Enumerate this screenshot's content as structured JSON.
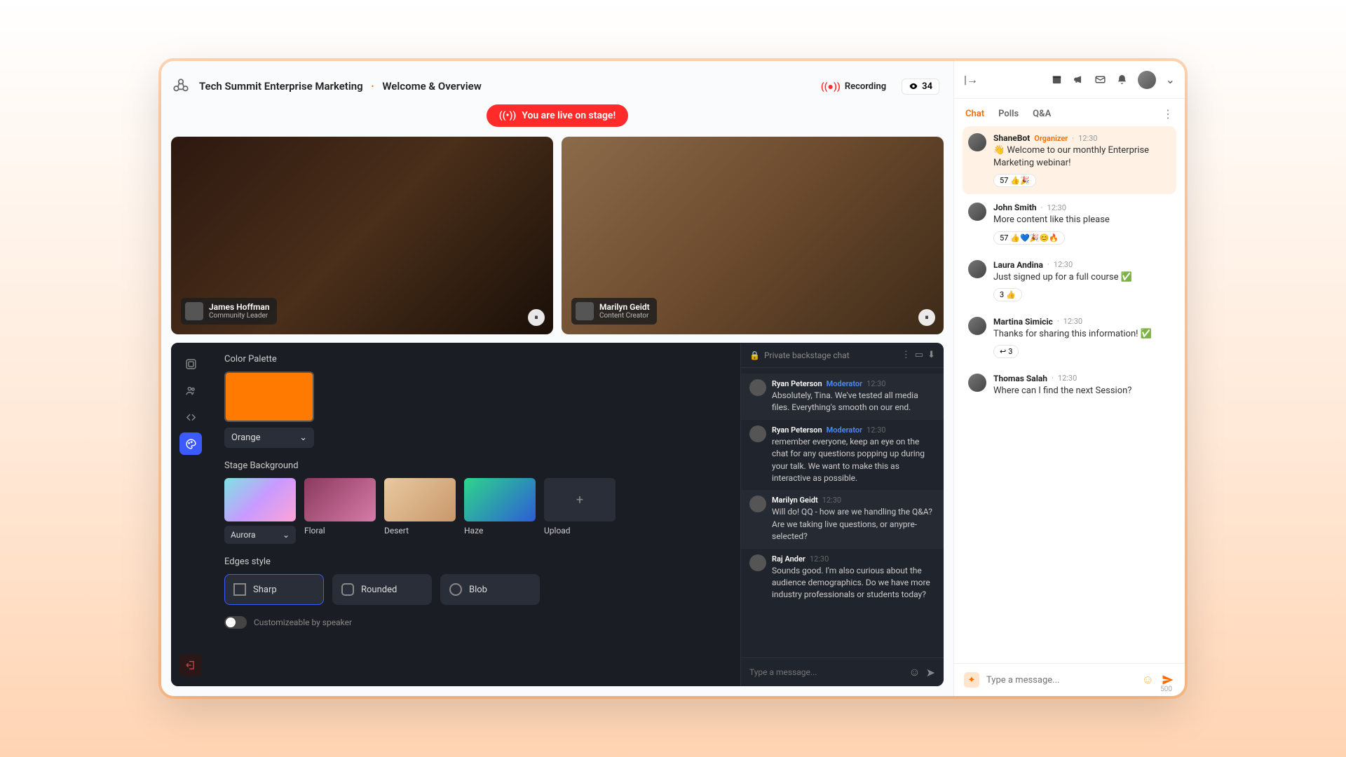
{
  "header": {
    "event_name": "Tech Summit Enterprise Marketing",
    "session_name": "Welcome & Overview",
    "recording_label": "Recording",
    "viewer_count": "34"
  },
  "live_banner": "You are live on stage!",
  "speakers": [
    {
      "name": "James Hoffman",
      "role": "Community Leader"
    },
    {
      "name": "Marilyn Geidt",
      "role": "Content Creator"
    }
  ],
  "panel": {
    "section_palette": "Color Palette",
    "color_name": "Orange",
    "section_bg": "Stage Background",
    "backgrounds": {
      "b0": "Aurora",
      "b1": "Floral",
      "b2": "Desert",
      "b3": "Haze",
      "b4": "Upload"
    },
    "section_edges": "Edges style",
    "edges": {
      "e0": "Sharp",
      "e1": "Rounded",
      "e2": "Blob"
    },
    "toggle_label": "Customizeable by speaker"
  },
  "backstage": {
    "title": "Private backstage chat",
    "msgs": [
      {
        "name": "Ryan Peterson",
        "tag": "Moderator",
        "time": "12:30",
        "text": "Absolutely, Tina. We've tested all media files. Everything's smooth on our end."
      },
      {
        "name": "Ryan Peterson",
        "tag": "Moderator",
        "time": "12:30",
        "text": "remember everyone, keep an eye on the chat for any questions popping up during your talk. We want to make this as interactive as possible."
      },
      {
        "name": "Marilyn Geidt",
        "tag": "",
        "time": "12:30",
        "text": "Will do! QQ - how are we handling the Q&A? Are we taking live questions, or anypre-selected?"
      },
      {
        "name": "Raj Ander",
        "tag": "",
        "time": "12:30",
        "text": "Sounds good. I'm also curious about the audience demographics. Do we have more industry professionals or students today?"
      }
    ],
    "placeholder": "Type a message..."
  },
  "sidebar_tabs": {
    "t0": "Chat",
    "t1": "Polls",
    "t2": "Q&A"
  },
  "chat": [
    {
      "name": "ShaneBot",
      "org": "Organizer",
      "time": "12:30",
      "text": "👋 Welcome to our monthly Enterprise Marketing webinar!",
      "react_count": "57",
      "react_emoji": "👍🎉",
      "pinned": true
    },
    {
      "name": "John Smith",
      "org": "",
      "time": "12:30",
      "text": "More content like this please",
      "react_count": "57",
      "react_emoji": "👍💙🎉😊🔥",
      "pinned": false
    },
    {
      "name": "Laura Andina",
      "org": "",
      "time": "12:30",
      "text": "Just signed up for a full course ✅",
      "react_count": "3",
      "react_emoji": "👍",
      "pinned": false
    },
    {
      "name": "Martina Simicic",
      "org": "",
      "time": "12:30",
      "text": "Thanks for sharing this information! ✅",
      "react_count": "3",
      "react_emoji": "↩",
      "pinned": false
    },
    {
      "name": "Thomas Salah",
      "org": "",
      "time": "12:30",
      "text": "Where can I find the next Session?",
      "react_count": "",
      "react_emoji": "",
      "pinned": false
    }
  ],
  "chat_input": {
    "placeholder": "Type a message...",
    "limit": "500"
  }
}
